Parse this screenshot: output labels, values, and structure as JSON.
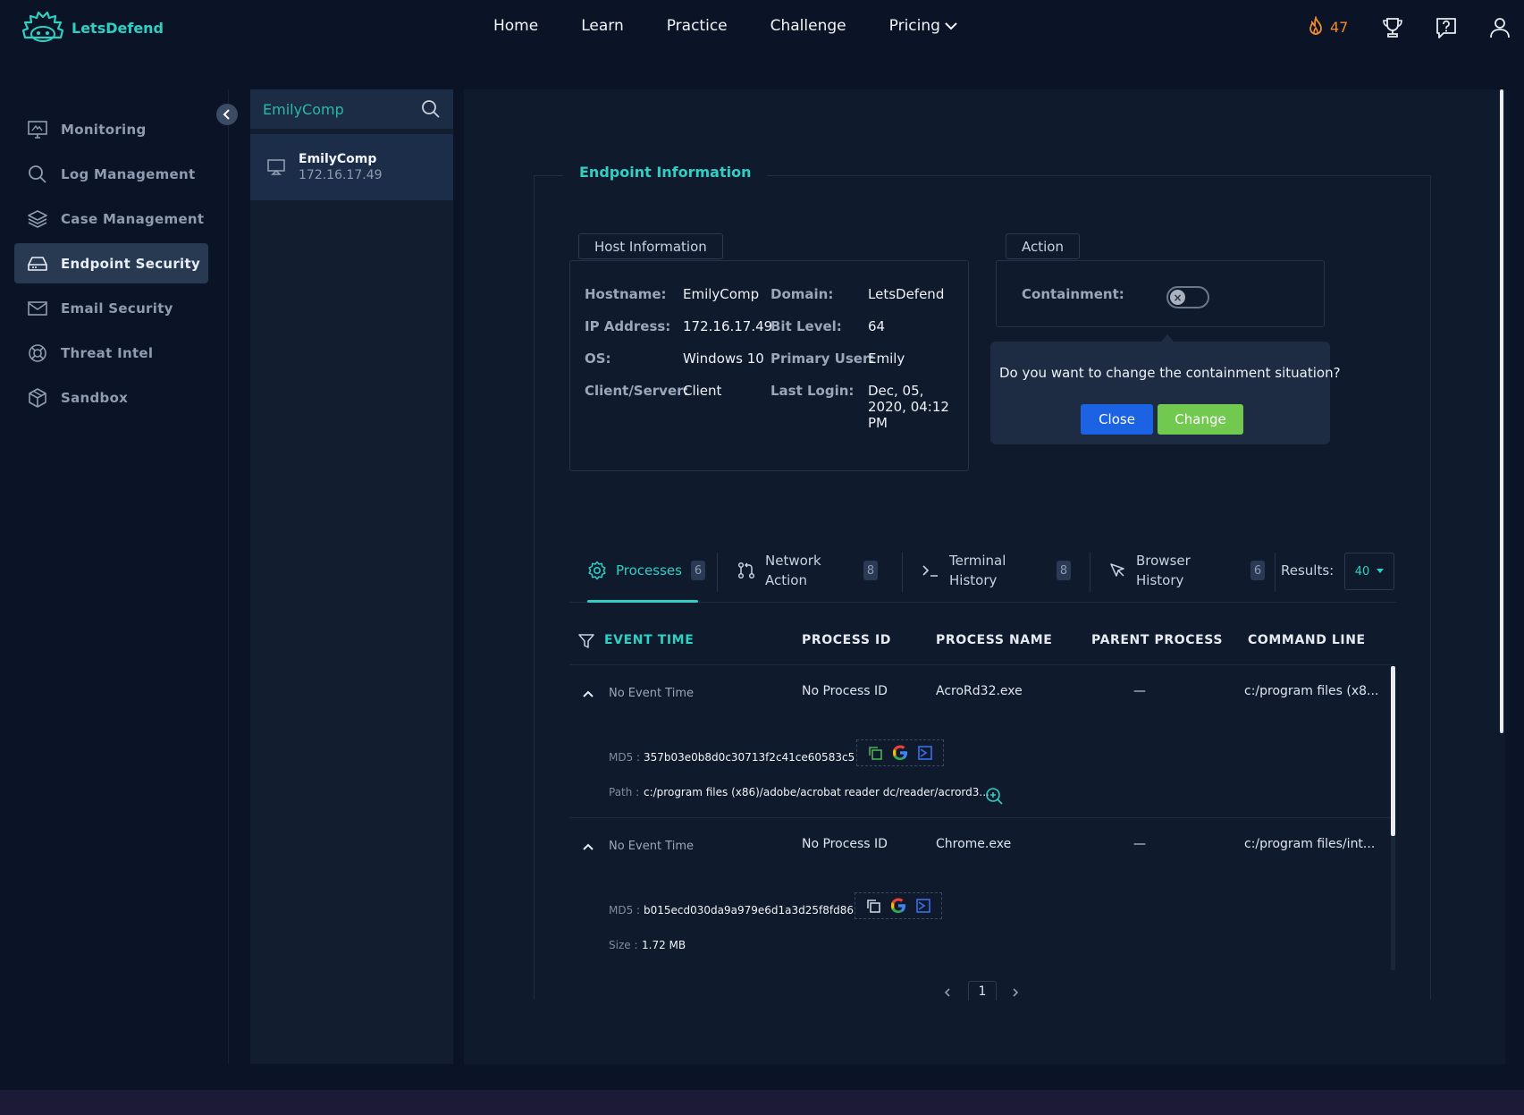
{
  "brand": {
    "name": "LetsDefend"
  },
  "nav": {
    "links": [
      "Home",
      "Learn",
      "Practice",
      "Challenge",
      "Pricing"
    ],
    "streak": "47"
  },
  "sidebar": {
    "items": [
      {
        "label": "Monitoring",
        "icon": "monitor-icon"
      },
      {
        "label": "Log Management",
        "icon": "search-icon"
      },
      {
        "label": "Case Management",
        "icon": "layers-icon"
      },
      {
        "label": "Endpoint Security",
        "icon": "hard-drive-icon",
        "active": true
      },
      {
        "label": "Email Security",
        "icon": "mail-icon"
      },
      {
        "label": "Threat Intel",
        "icon": "lifebuoy-icon"
      },
      {
        "label": "Sandbox",
        "icon": "box-icon"
      }
    ]
  },
  "search": {
    "value": "EmilyComp",
    "result": {
      "name": "EmilyComp",
      "ip": "172.16.17.49"
    }
  },
  "endpoint": {
    "title": "Endpoint Information",
    "host_tab": "Host Information",
    "action_tab": "Action",
    "fields": {
      "hostname_label": "Hostname:",
      "hostname": "EmilyComp",
      "domain_label": "Domain:",
      "domain": "LetsDefend",
      "ip_label": "IP Address:",
      "ip": "172.16.17.49",
      "bit_label": "Bit Level:",
      "bit": "64",
      "os_label": "OS:",
      "os": "Windows 10",
      "user_label": "Primary User:",
      "user": "Emily",
      "client_label": "Client/Server:",
      "client": "Client",
      "login_label": "Last Login:",
      "login_1": "Dec, 05,",
      "login_2": "2020, 04:12",
      "login_3": "PM"
    },
    "containment_label": "Containment:",
    "popover": {
      "text": "Do you want to change the containment situation?",
      "close": "Close",
      "change": "Change"
    }
  },
  "tabs": [
    {
      "label": "Processes",
      "count": "6"
    },
    {
      "label_1": "Network",
      "label_2": "Action",
      "count": "8"
    },
    {
      "label_1": "Terminal",
      "label_2": "History",
      "count": "8"
    },
    {
      "label_1": "Browser",
      "label_2": "History",
      "count": "6"
    }
  ],
  "results": {
    "label": "Results:",
    "value": "40"
  },
  "table": {
    "headers": [
      "EVENT TIME",
      "PROCESS ID",
      "PROCESS NAME",
      "PARENT PROCESS",
      "COMMAND LINE"
    ],
    "rows": [
      {
        "event_time": "No Event Time",
        "process_id": "No Process ID",
        "process_name": "AcroRd32.exe",
        "parent": "—",
        "command": "c:/program files (x8...",
        "md5_label": "MD5 :",
        "md5": "357b03e0b8d0c30713f2c41ce60583c5",
        "extra_label": "Path :",
        "extra": "c:/program files (x86)/adobe/acrobat reader dc/reader/acrord3..."
      },
      {
        "event_time": "No Event Time",
        "process_id": "No Process ID",
        "process_name": "Chrome.exe",
        "parent": "—",
        "command": "c:/program files/int...",
        "md5_label": "MD5 :",
        "md5": "b015ecd030da9a979e6d1a3d25f8fd86",
        "extra_label": "Size :",
        "extra": "1.72 MB"
      }
    ]
  },
  "pager": {
    "current": "1"
  },
  "colors": {
    "accent": "#2fd0c3",
    "close": "#1b63e3",
    "change": "#72c94f",
    "streak": "#f08a2c"
  }
}
